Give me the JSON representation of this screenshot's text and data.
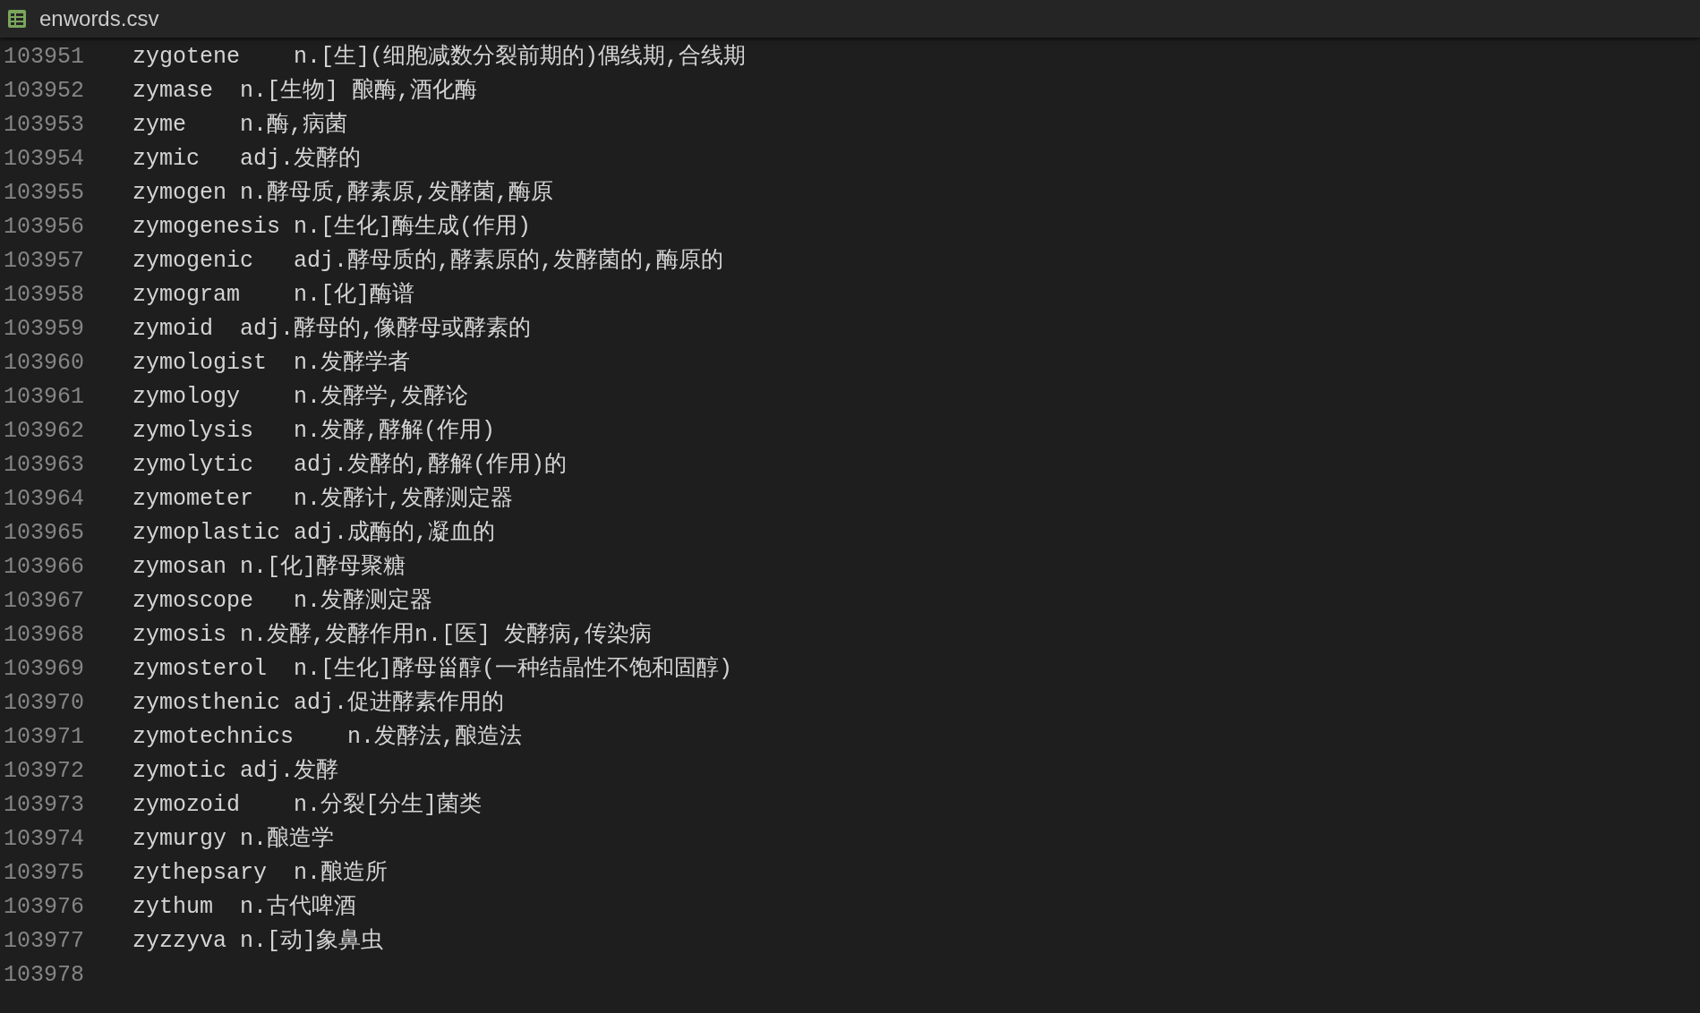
{
  "tab": {
    "title": "enwords.csv"
  },
  "lines": [
    {
      "number": "103951",
      "text": "zygotene\tn.[生](细胞减数分裂前期的)偶线期,合线期"
    },
    {
      "number": "103952",
      "text": "zymase\tn.[生物] 酿酶,酒化酶"
    },
    {
      "number": "103953",
      "text": "zyme\tn.酶,病菌"
    },
    {
      "number": "103954",
      "text": "zymic\tadj.发酵的"
    },
    {
      "number": "103955",
      "text": "zymogen n.酵母质,酵素原,发酵菌,酶原"
    },
    {
      "number": "103956",
      "text": "zymogenesis n.[生化]酶生成(作用)"
    },
    {
      "number": "103957",
      "text": "zymogenic\tadj.酵母质的,酵素原的,发酵菌的,酶原的"
    },
    {
      "number": "103958",
      "text": "zymogram\tn.[化]酶谱"
    },
    {
      "number": "103959",
      "text": "zymoid\tadj.酵母的,像酵母或酵素的"
    },
    {
      "number": "103960",
      "text": "zymologist\tn.发酵学者"
    },
    {
      "number": "103961",
      "text": "zymology\tn.发酵学,发酵论"
    },
    {
      "number": "103962",
      "text": "zymolysis\tn.发酵,酵解(作用)"
    },
    {
      "number": "103963",
      "text": "zymolytic\tadj.发酵的,酵解(作用)的"
    },
    {
      "number": "103964",
      "text": "zymometer\tn.发酵计,发酵测定器"
    },
    {
      "number": "103965",
      "text": "zymoplastic adj.成酶的,凝血的"
    },
    {
      "number": "103966",
      "text": "zymosan n.[化]酵母聚糖"
    },
    {
      "number": "103967",
      "text": "zymoscope\tn.发酵测定器"
    },
    {
      "number": "103968",
      "text": "zymosis n.发酵,发酵作用n.[医] 发酵病,传染病"
    },
    {
      "number": "103969",
      "text": "zymosterol\tn.[生化]酵母甾醇(一种结晶性不饱和固醇)"
    },
    {
      "number": "103970",
      "text": "zymosthenic adj.促进酵素作用的"
    },
    {
      "number": "103971",
      "text": "zymotechnics\tn.发酵法,酿造法"
    },
    {
      "number": "103972",
      "text": "zymotic adj.发酵"
    },
    {
      "number": "103973",
      "text": "zymozoid\tn.分裂[分生]菌类"
    },
    {
      "number": "103974",
      "text": "zymurgy n.酿造学"
    },
    {
      "number": "103975",
      "text": "zythepsary\tn.酿造所"
    },
    {
      "number": "103976",
      "text": "zythum\tn.古代啤酒"
    },
    {
      "number": "103977",
      "text": "zyzzyva n.[动]象鼻虫"
    },
    {
      "number": "103978"
    }
  ]
}
